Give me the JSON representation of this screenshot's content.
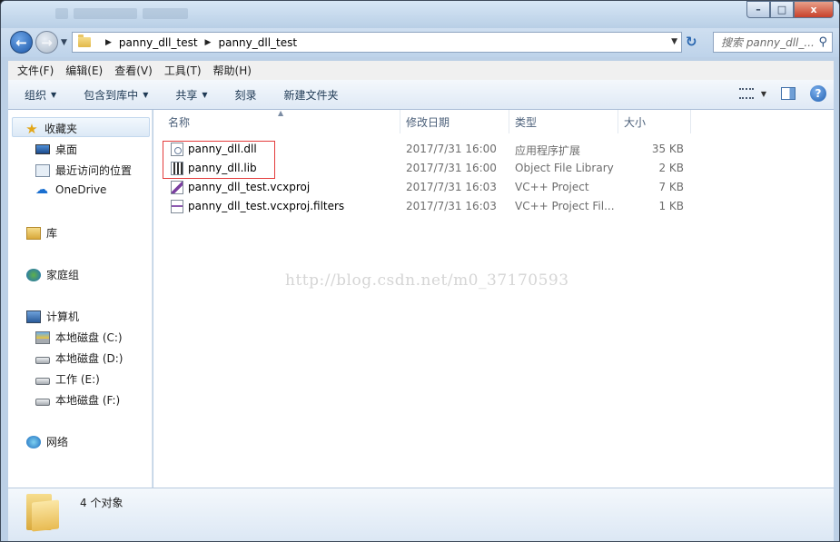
{
  "window": {
    "caption": {
      "minimize": "–",
      "maximize": "□",
      "close": "x"
    }
  },
  "address": {
    "crumbs": [
      "panny_dll_test",
      "panny_dll_test"
    ],
    "search_placeholder": "搜索 panny_dll_..."
  },
  "menu": [
    "文件(F)",
    "编辑(E)",
    "查看(V)",
    "工具(T)",
    "帮助(H)"
  ],
  "toolbar": {
    "organize": "组织",
    "include_in_library": "包含到库中",
    "share": "共享",
    "burn": "刻录",
    "new_folder": "新建文件夹"
  },
  "sidebar": {
    "favorites": "收藏夹",
    "desktop": "桌面",
    "recent": "最近访问的位置",
    "onedrive": "OneDrive",
    "libraries": "库",
    "homegroup": "家庭组",
    "computer": "计算机",
    "drive_c": "本地磁盘 (C:)",
    "drive_d": "本地磁盘 (D:)",
    "drive_e": "工作 (E:)",
    "drive_f": "本地磁盘 (F:)",
    "network": "网络"
  },
  "columns": {
    "name": "名称",
    "date": "修改日期",
    "type": "类型",
    "size": "大小"
  },
  "files": [
    {
      "name": "panny_dll.dll",
      "date": "2017/7/31 16:00",
      "type": "应用程序扩展",
      "size": "35 KB",
      "icon": "dll-icon"
    },
    {
      "name": "panny_dll.lib",
      "date": "2017/7/31 16:00",
      "type": "Object File Library",
      "size": "2 KB",
      "icon": "lib-icon"
    },
    {
      "name": "panny_dll_test.vcxproj",
      "date": "2017/7/31 16:03",
      "type": "VC++ Project",
      "size": "7 KB",
      "icon": "vcxproj-icon"
    },
    {
      "name": "panny_dll_test.vcxproj.filters",
      "date": "2017/7/31 16:03",
      "type": "VC++ Project Fil...",
      "size": "1 KB",
      "icon": "filters-icon"
    }
  ],
  "watermark": "http://blog.csdn.net/m0_37170593",
  "status": {
    "count": "4 个对象"
  },
  "colors": {
    "highlight_box": "#e33b3b",
    "window_frame": "#bcd0e6"
  }
}
